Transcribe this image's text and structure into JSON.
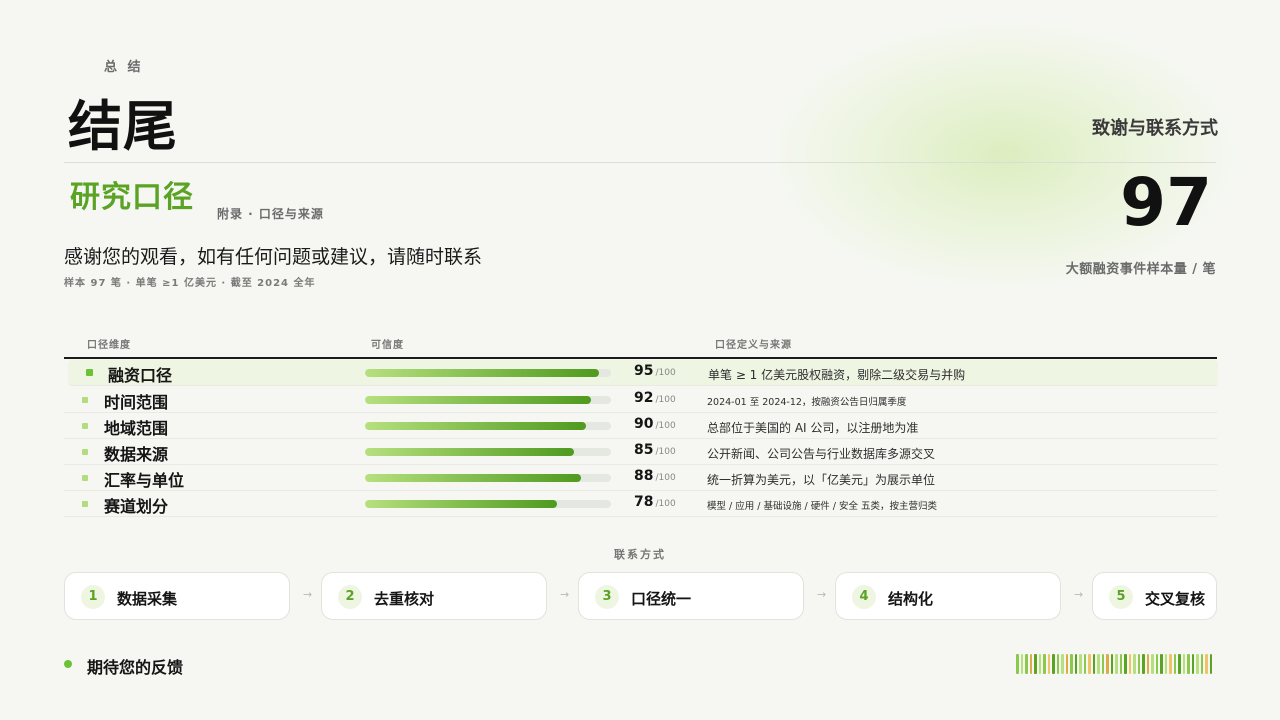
{
  "header": {
    "kicker": "总 结",
    "title": "结尾",
    "right_subtitle": "致谢与联系方式"
  },
  "section": {
    "title": "研究口径",
    "appendix": "附录 · 口径与来源",
    "thanks": "感谢您的观看，如有任何问题或建议，请随时联系",
    "meta": "样本 97 笔 · 单笔 ≥1 亿美元 · 截至 2024 全年"
  },
  "stat": {
    "value": "97",
    "caption": "大额融资事件样本量 / 笔"
  },
  "table": {
    "headers": [
      "口径维度",
      "可信度",
      "口径定义与来源"
    ],
    "max_label": "/100",
    "rows": [
      {
        "name": "融资口径",
        "score": "95",
        "score_fraction": 0.95,
        "desc": "单笔 ≥ 1 亿美元股权融资，剔除二级交易与并购",
        "highlight": true
      },
      {
        "name": "时间范围",
        "score": "92",
        "score_fraction": 0.92,
        "desc": "2024-01 至 2024-12，按融资公告日归属季度",
        "small": true
      },
      {
        "name": "地域范围",
        "score": "90",
        "score_fraction": 0.9,
        "desc": "总部位于美国的 AI 公司，以注册地为准"
      },
      {
        "name": "数据来源",
        "score": "85",
        "score_fraction": 0.85,
        "desc": "公开新闻、公司公告与行业数据库多源交叉"
      },
      {
        "name": "汇率与单位",
        "score": "88",
        "score_fraction": 0.88,
        "desc": "统一折算为美元，以「亿美元」为展示单位"
      },
      {
        "name": "赛道划分",
        "score": "78",
        "score_fraction": 0.78,
        "desc": "模型 / 应用 / 基础设施 / 硬件 / 安全 五类，按主营归类",
        "small": true
      }
    ]
  },
  "contact": {
    "label": "联系方式",
    "steps": [
      {
        "num": "1",
        "label": "数据采集"
      },
      {
        "num": "2",
        "label": "去重核对"
      },
      {
        "num": "3",
        "label": "口径统一"
      },
      {
        "num": "4",
        "label": "结构化"
      },
      {
        "num": "5",
        "label": "交叉复核"
      }
    ],
    "arrow": "→"
  },
  "footer": {
    "feedback": "期待您的反馈"
  },
  "colors": {
    "accent": "#5aa324",
    "accent_light": "#b6e07e",
    "stripe_palette": [
      "#8cc84b",
      "#e0a94a",
      "#5aa324",
      "#b6e07e",
      "#f0c36a"
    ]
  }
}
